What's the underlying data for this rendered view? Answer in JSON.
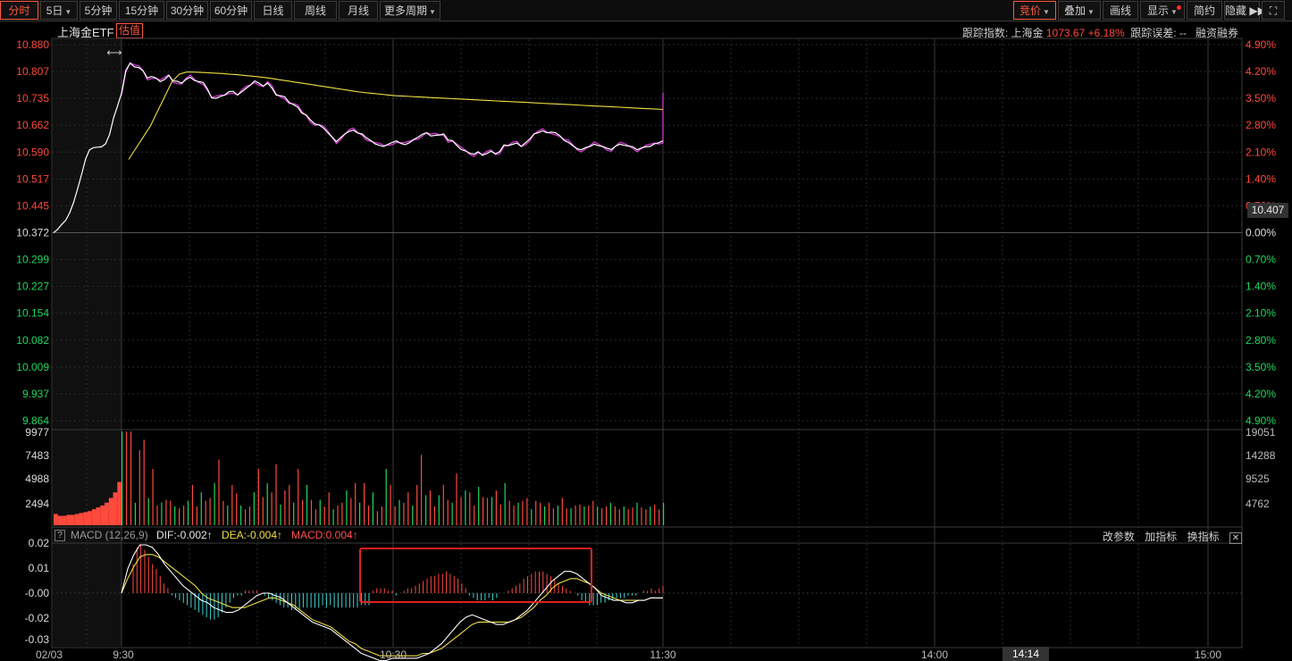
{
  "toolbar": {
    "left": [
      {
        "id": "fenshi",
        "label": "分时",
        "active": true
      },
      {
        "id": "5day",
        "label": "5日",
        "dropdown": true
      },
      {
        "id": "5min",
        "label": "5分钟"
      },
      {
        "id": "15min",
        "label": "15分钟"
      },
      {
        "id": "30min",
        "label": "30分钟"
      },
      {
        "id": "60min",
        "label": "60分钟"
      },
      {
        "id": "daily",
        "label": "日线"
      },
      {
        "id": "weekly",
        "label": "周线"
      },
      {
        "id": "monthly",
        "label": "月线"
      },
      {
        "id": "more",
        "label": "更多周期",
        "dropdown": true
      }
    ],
    "right": [
      {
        "id": "bid",
        "label": "竞价",
        "dropdown": true,
        "active": true
      },
      {
        "id": "overlay",
        "label": "叠加",
        "dropdown": true
      },
      {
        "id": "draw",
        "label": "画线"
      },
      {
        "id": "display",
        "label": "显示",
        "dropdown": true,
        "dot": true
      },
      {
        "id": "brief",
        "label": "简约"
      },
      {
        "id": "hide",
        "label": "隐藏 ▶▶"
      },
      {
        "id": "fullscreen",
        "label": "⛶"
      }
    ]
  },
  "header": {
    "title": "上海金ETF",
    "est_tag": "估值",
    "tracking_label": "跟踪指数: 上海金",
    "tracking_value": "1073.67",
    "tracking_pct": "+6.18%",
    "error_label": "跟踪误差: --",
    "margin_label": "融资融券"
  },
  "price_axis": {
    "left_labels": [
      "10.880",
      "10.807",
      "10.735",
      "10.662",
      "10.590",
      "10.517",
      "10.445",
      "10.372",
      "10.299",
      "10.227",
      "10.154",
      "10.082",
      "10.009",
      "9.937",
      "9.864"
    ],
    "right_labels": [
      "4.90%",
      "4.20%",
      "3.50%",
      "2.80%",
      "2.10%",
      "1.40%",
      "0.70%",
      "0.00%",
      "0.70%",
      "1.40%",
      "2.10%",
      "2.80%",
      "3.50%",
      "4.20%",
      "4.90%"
    ],
    "current_price": "10.407"
  },
  "volume_axis": {
    "left_labels": [
      "9977",
      "7483",
      "4988",
      "2494"
    ],
    "right_labels": [
      "19051",
      "14288",
      "9525",
      "4762"
    ]
  },
  "macd": {
    "name": "MACD (12,26,9)",
    "dif": "DIF:-0.002↑",
    "dea": "DEA:-0.004↑",
    "macd": "MACD:0.004↑",
    "y_labels": [
      "0.02",
      "0.01",
      "-0.00",
      "-0.02",
      "-0.03"
    ],
    "buttons": [
      "改参数",
      "加指标",
      "换指标"
    ],
    "close": "✕"
  },
  "time_axis": {
    "labels": [
      "02/03",
      "9:30",
      "10:30",
      "11:30",
      "14:00",
      "15:00"
    ],
    "cursor": "14:14"
  },
  "colors": {
    "up": "#ff4a3c",
    "down": "#1ed760",
    "price": "#ffffff",
    "avg": "#f0e040",
    "estimate": "#e040e0",
    "macd_neg": "#3fd3d3",
    "highlight": "#e02020"
  },
  "chart_data": {
    "type": "line",
    "series": [
      {
        "key": "price",
        "values": [
          10.372,
          10.381,
          10.394,
          10.405,
          10.425,
          10.454,
          10.49,
          10.529,
          10.571,
          10.596,
          10.602,
          10.603,
          10.604,
          10.612,
          10.637,
          10.682,
          10.714,
          10.749,
          10.81,
          10.83,
          10.82,
          10.818,
          10.81,
          10.79,
          10.794,
          10.79,
          10.78,
          10.786,
          10.797,
          10.782,
          10.781,
          10.776,
          10.786,
          10.792,
          10.783,
          10.78,
          10.778,
          10.76,
          10.736,
          10.735,
          10.74,
          10.744,
          10.753,
          10.754,
          10.744,
          10.753,
          10.762,
          10.771,
          10.782,
          10.776,
          10.768,
          10.776,
          10.763,
          10.744,
          10.742,
          10.739,
          10.724,
          10.718,
          10.711,
          10.695,
          10.69,
          10.676,
          10.666,
          10.663,
          10.655,
          10.642,
          10.63,
          10.618,
          10.629,
          10.639,
          10.646,
          10.649,
          10.641,
          10.639,
          10.628,
          10.621,
          10.612,
          10.608,
          10.605,
          10.611,
          10.616,
          10.62,
          10.613,
          10.61,
          10.615,
          10.624,
          10.63,
          10.638,
          10.642,
          10.633,
          10.635,
          10.636,
          10.639,
          10.622,
          10.621,
          10.608,
          10.597,
          10.593,
          10.587,
          10.584,
          10.591,
          10.581,
          10.586,
          10.592,
          10.585,
          10.591,
          10.609,
          10.607,
          10.611,
          10.614,
          10.605,
          10.615,
          10.625,
          10.639,
          10.642,
          10.647,
          10.642,
          10.644,
          10.642,
          10.634,
          10.621,
          10.616,
          10.607,
          10.599,
          10.596,
          10.602,
          10.605,
          10.611,
          10.607,
          10.605,
          10.6,
          10.597,
          10.606,
          10.611,
          10.608,
          10.606,
          10.604,
          10.596,
          10.601,
          10.604,
          10.605,
          10.612,
          10.615,
          10.62
        ]
      },
      {
        "key": "avg",
        "values": [
          10.57,
          10.6,
          10.63,
          10.66,
          10.7,
          10.74,
          10.78,
          10.8,
          10.806,
          10.806,
          10.805,
          10.804,
          10.803,
          10.802,
          10.8,
          10.799,
          10.797,
          10.795,
          10.793,
          10.791,
          10.788,
          10.785,
          10.782,
          10.779,
          10.776,
          10.773,
          10.77,
          10.767,
          10.764,
          10.761,
          10.758,
          10.755,
          10.752,
          10.75,
          10.748,
          10.746,
          10.744,
          10.742,
          10.741,
          10.74,
          10.739,
          10.738,
          10.737,
          10.736,
          10.735,
          10.734,
          10.733,
          10.732,
          10.731,
          10.73,
          10.729,
          10.728,
          10.727,
          10.726,
          10.725,
          10.724,
          10.723,
          10.722,
          10.721,
          10.72,
          10.719,
          10.718,
          10.717,
          10.716,
          10.715,
          10.714,
          10.713,
          10.712,
          10.711,
          10.71,
          10.709,
          10.708,
          10.707,
          10.706,
          10.705
        ]
      },
      {
        "key": "volume",
        "values": [
          1200,
          1000,
          1000,
          1100,
          1100,
          1200,
          1300,
          1400,
          1500,
          1700,
          1900,
          2100,
          2400,
          2900,
          3500,
          4600,
          9977,
          9977,
          9977,
          2394,
          7983,
          9091,
          2888,
          5988,
          2094,
          2394,
          2694,
          2594,
          1994,
          1794,
          2094,
          2594,
          4288,
          1994,
          3493,
          2594,
          2894,
          4488,
          6987,
          2594,
          2094,
          4288,
          3393,
          2094,
          1694,
          1994,
          3493,
          5988,
          2994,
          4488,
          3493,
          6487,
          2194,
          3693,
          4288,
          2394,
          5988,
          2694,
          4288,
          2694,
          1694,
          2694,
          1994,
          3493,
          1694,
          2094,
          2394,
          3693,
          2894,
          4488,
          2394,
          4488,
          2094,
          3493,
          1494,
          1994,
          5988,
          4288,
          1994,
          2694,
          2394,
          3493,
          2094,
          4288,
          7483,
          3193,
          3693,
          1994,
          3193,
          4288,
          2694,
          2394,
          5488,
          2994,
          3693,
          3493,
          2094,
          4088,
          2994,
          2894,
          2994,
          3693,
          2194,
          4488,
          2594,
          2094,
          2394,
          2594,
          2894,
          1694,
          2594,
          2394,
          1994,
          2394,
          1794,
          2094,
          2894,
          1794,
          1794,
          2094,
          2194,
          1994,
          2094,
          2594,
          1994,
          1794,
          1994,
          2394,
          1994,
          1694,
          1994,
          1694,
          1894,
          2394,
          1894,
          1694,
          1994,
          2194,
          1694,
          2394
        ]
      },
      {
        "key": "macd_hist",
        "values": [
          0.0,
          0.0,
          0.0,
          0.012,
          0.019,
          0.02,
          0.018,
          0.015,
          0.012,
          0.01,
          0.007,
          0.004,
          0.002,
          -0.001,
          -0.002,
          -0.003,
          -0.004,
          -0.005,
          -0.006,
          -0.007,
          -0.008,
          -0.009,
          -0.01,
          -0.011,
          -0.011,
          -0.01,
          -0.008,
          -0.006,
          -0.004,
          -0.002,
          -0.001,
          -0.001,
          0.001,
          0.001,
          0.001,
          0.001,
          0.0,
          -0.001,
          -0.002,
          -0.003,
          -0.004,
          -0.005,
          -0.006,
          -0.006,
          -0.007,
          -0.007,
          -0.007,
          -0.006,
          -0.006,
          -0.006,
          -0.006,
          -0.006,
          -0.005,
          -0.006,
          -0.005,
          -0.006,
          -0.006,
          -0.006,
          -0.006,
          -0.006,
          -0.006,
          -0.006,
          -0.005,
          -0.005,
          -0.005,
          0.001,
          0.002,
          0.002,
          0.002,
          0.001,
          0.001,
          -0.001,
          0.0,
          0.001,
          0.002,
          0.002,
          0.003,
          0.004,
          0.005,
          0.006,
          0.007,
          0.007,
          0.008,
          0.008,
          0.009,
          0.008,
          0.007,
          0.006,
          0.004,
          0.002,
          -0.001,
          -0.002,
          -0.003,
          -0.003,
          -0.003,
          -0.002,
          -0.003,
          -0.002,
          0.0,
          0.0,
          0.001,
          0.002,
          0.003,
          0.004,
          0.006,
          0.007,
          0.008,
          0.009,
          0.009,
          0.009,
          0.008,
          0.007,
          0.006,
          0.004,
          0.003,
          0.002,
          0.001,
          0.0,
          -0.001,
          -0.003,
          -0.004,
          -0.005,
          -0.005,
          -0.005,
          -0.004,
          -0.004,
          -0.003,
          -0.003,
          -0.002,
          -0.002,
          -0.002,
          -0.001,
          -0.001,
          -0.001,
          0.0,
          0.001,
          0.001,
          0.002,
          0.001,
          0.002,
          0.003
        ]
      },
      {
        "key": "dif",
        "values": [
          0.0,
          0.01,
          0.016,
          0.02,
          0.02,
          0.019,
          0.016,
          0.012,
          0.009,
          0.006,
          0.003,
          0.001,
          -0.001,
          -0.003,
          -0.004,
          -0.006,
          -0.007,
          -0.008,
          -0.008,
          -0.007,
          -0.005,
          -0.003,
          -0.001,
          0.0,
          0.0,
          -0.001,
          -0.002,
          -0.004,
          -0.006,
          -0.008,
          -0.01,
          -0.012,
          -0.013,
          -0.014,
          -0.015,
          -0.017,
          -0.019,
          -0.021,
          -0.023,
          -0.025,
          -0.026,
          -0.027,
          -0.028,
          -0.028,
          -0.027,
          -0.027,
          -0.027,
          -0.027,
          -0.027,
          -0.026,
          -0.025,
          -0.023,
          -0.021,
          -0.018,
          -0.015,
          -0.012,
          -0.01,
          -0.009,
          -0.01,
          -0.011,
          -0.012,
          -0.013,
          -0.013,
          -0.012,
          -0.011,
          -0.009,
          -0.007,
          -0.004,
          -0.001,
          0.002,
          0.005,
          0.007,
          0.009,
          0.009,
          0.008,
          0.006,
          0.004,
          0.002,
          -0.001,
          -0.002,
          -0.003,
          -0.003,
          -0.004,
          -0.004,
          -0.003,
          -0.003,
          -0.002,
          -0.002,
          -0.002
        ]
      },
      {
        "key": "dea",
        "values": [
          0.0,
          0.006,
          0.011,
          0.015,
          0.016,
          0.016,
          0.015,
          0.013,
          0.011,
          0.009,
          0.007,
          0.005,
          0.003,
          0.0,
          -0.002,
          -0.003,
          -0.004,
          -0.005,
          -0.006,
          -0.006,
          -0.006,
          -0.005,
          -0.004,
          -0.003,
          -0.002,
          -0.002,
          -0.003,
          -0.004,
          -0.005,
          -0.007,
          -0.009,
          -0.011,
          -0.012,
          -0.013,
          -0.014,
          -0.016,
          -0.018,
          -0.02,
          -0.021,
          -0.023,
          -0.024,
          -0.025,
          -0.026,
          -0.026,
          -0.026,
          -0.026,
          -0.026,
          -0.026,
          -0.026,
          -0.025,
          -0.025,
          -0.024,
          -0.023,
          -0.021,
          -0.019,
          -0.017,
          -0.015,
          -0.013,
          -0.012,
          -0.012,
          -0.012,
          -0.012,
          -0.012,
          -0.012,
          -0.011,
          -0.01,
          -0.008,
          -0.006,
          -0.003,
          -0.001,
          0.002,
          0.004,
          0.005,
          0.006,
          0.006,
          0.005,
          0.004,
          0.002,
          0.0,
          -0.001,
          -0.002,
          -0.003,
          -0.003,
          -0.003,
          -0.003,
          -0.003,
          -0.002,
          -0.002,
          -0.002
        ]
      }
    ]
  }
}
